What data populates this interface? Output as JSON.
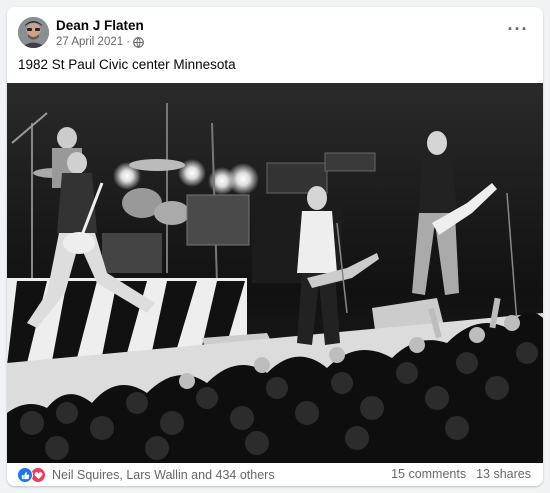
{
  "post": {
    "author": "Dean J Flaten",
    "date": "27 April 2021",
    "date_separator": "·",
    "audience_icon": "globe-icon",
    "caption": "1982 St Paul Civic center Minnesota",
    "more_icon": "more-options-icon"
  },
  "photo": {
    "subject": "black-and-white concert photograph"
  },
  "footer": {
    "reaction_icons": [
      "like-icon",
      "love-icon"
    ],
    "reactions_text": "Neil Squires, Lars Wallin and 434 others",
    "comments": "15 comments",
    "shares": "13 shares"
  },
  "colors": {
    "background": "#f0f2f5",
    "card": "#ffffff",
    "secondary_text": "#65676b",
    "like_blue": "#1877f2",
    "love_red": "#f33e58"
  }
}
